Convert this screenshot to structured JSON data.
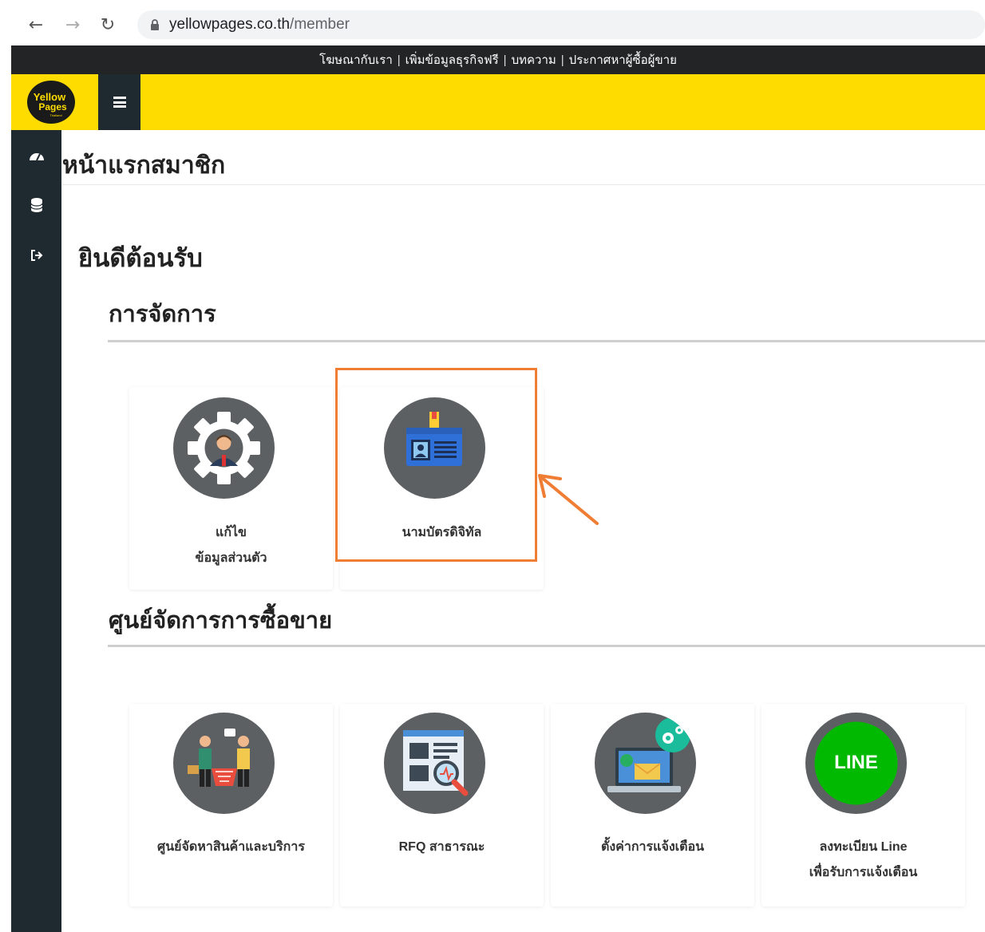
{
  "browser": {
    "back_icon": "arrow-left-icon",
    "forward_icon": "arrow-right-icon",
    "reload_icon": "reload-icon",
    "url_domain": "yellowpages.co.th",
    "url_path": "/member"
  },
  "top_strip": {
    "links": [
      "โฆษณากับเรา",
      "เพิ่มข้อมูลธุรกิจฟรี",
      "บทความ",
      "ประกาศหาผู้ซื้อผู้ขาย"
    ],
    "separator": "|"
  },
  "header": {
    "logo_text": [
      "Yellow",
      "Pages"
    ],
    "logo_small": "Thailand"
  },
  "sidebar": {
    "items": [
      {
        "icon": "dashboard-icon"
      },
      {
        "icon": "database-icon"
      },
      {
        "icon": "logout-icon"
      }
    ]
  },
  "main": {
    "page_title": "หน้าแรกสมาชิก",
    "welcome": "ยินดีต้อนรับ",
    "sections": [
      {
        "title": "การจัดการ",
        "cards": [
          {
            "label_line1": "แก้ไข",
            "label_line2": "ข้อมูลส่วนตัว",
            "icon": "profile-gear-icon"
          },
          {
            "label_line1": "นามบัตรดิจิทัล",
            "label_line2": "",
            "icon": "id-card-icon"
          }
        ]
      },
      {
        "title": "ศูนย์จัดการการซื้อขาย",
        "cards": [
          {
            "label_line1": "ศูนย์จัดหาสินค้าและบริการ",
            "label_line2": "",
            "icon": "buyers-sellers-icon"
          },
          {
            "label_line1": "RFQ สาธารณะ",
            "label_line2": "",
            "icon": "rfq-document-icon"
          },
          {
            "label_line1": "ตั้งค่าการแจ้งเตือน",
            "label_line2": "",
            "icon": "notification-laptop-icon"
          },
          {
            "label_line1": "ลงทะเบียน Line",
            "label_line2": "เพื่อรับการแจ้งเตือน",
            "icon": "line-icon"
          }
        ]
      }
    ],
    "line_badge_text": "LINE"
  },
  "colors": {
    "brand_yellow": "#ffdc00",
    "sidebar_dark": "#1f2a30",
    "highlight_orange": "#ef7d33",
    "icon_gray": "#5d6062"
  }
}
